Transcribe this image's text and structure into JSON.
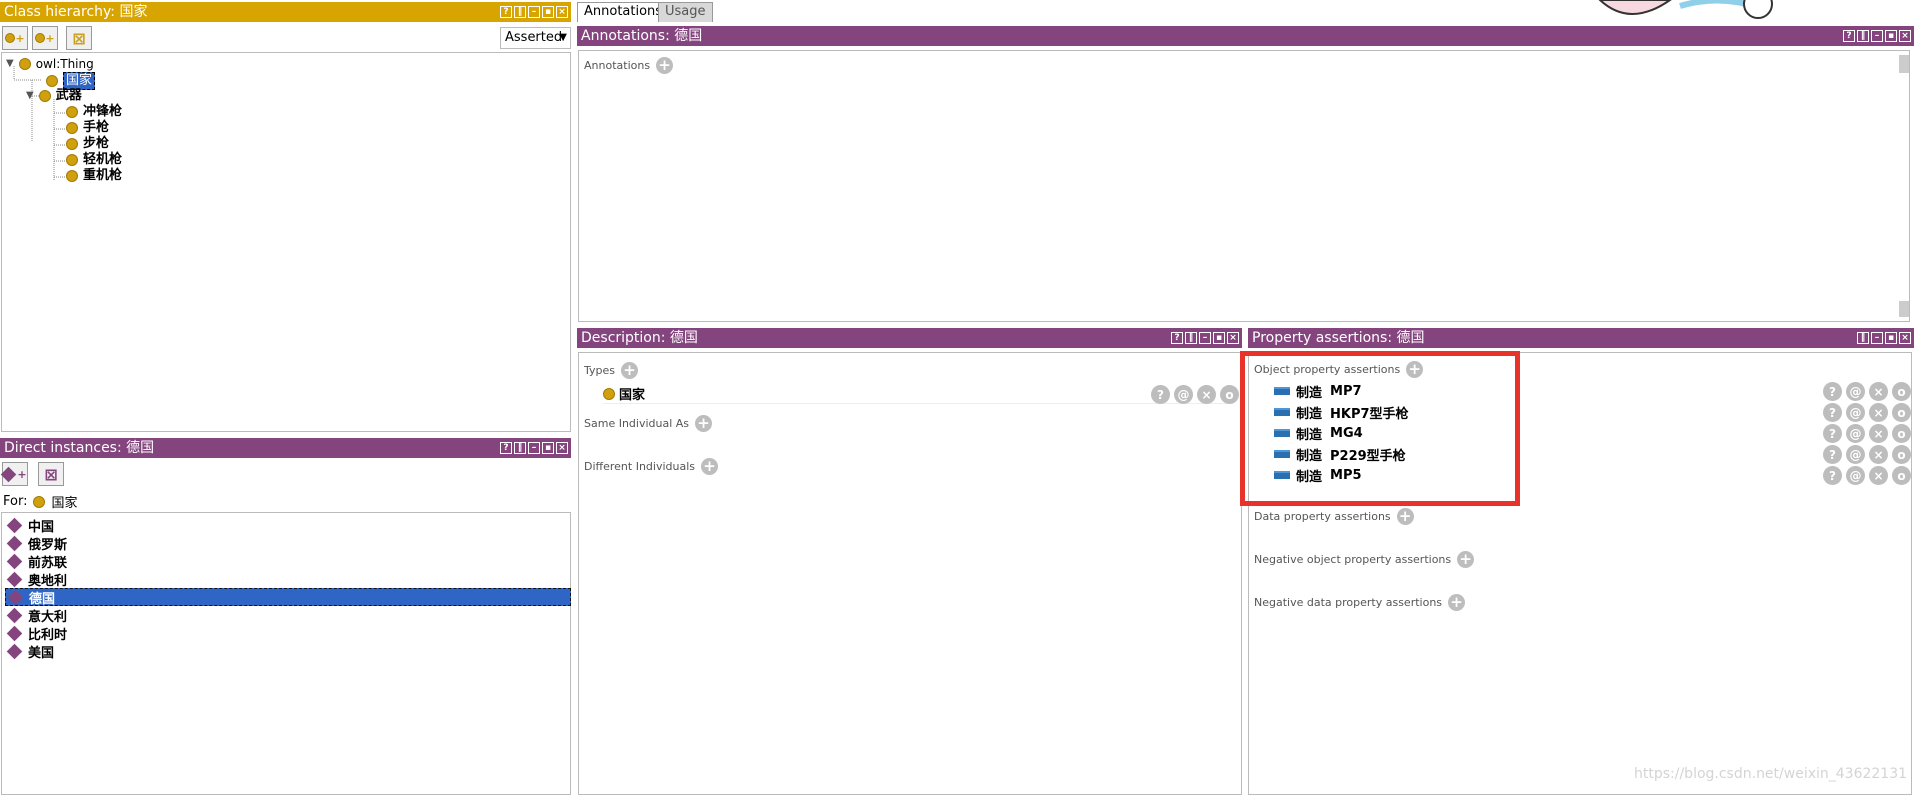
{
  "class_hierarchy": {
    "title": "Class hierarchy: 国家",
    "reasoner_mode": "Asserted",
    "tree": {
      "root": "owl:Thing",
      "n1": "国家",
      "n2": "武器",
      "children": [
        "冲锋枪",
        "手枪",
        "步枪",
        "轻机枪",
        "重机枪"
      ]
    }
  },
  "direct_instances": {
    "title": "Direct instances: 德国",
    "for_label": "For:",
    "for_value": "国家",
    "items": [
      "中国",
      "俄罗斯",
      "前苏联",
      "奥地利",
      "德国",
      "意大利",
      "比利时",
      "美国"
    ],
    "selected_index": 4
  },
  "tabs": {
    "annotations": "Annotations",
    "usage": "Usage"
  },
  "annotations_panel": {
    "title": "Annotations: 德国",
    "section": "Annotations"
  },
  "description": {
    "title": "Description: 德国",
    "types_label": "Types",
    "type_value": "国家",
    "same_individual": "Same Individual As",
    "different_individuals": "Different Individuals"
  },
  "property_assertions": {
    "title": "Property assertions: 德国",
    "object_label": "Object property assertions",
    "rows": [
      {
        "prop": "制造",
        "value": "MP7"
      },
      {
        "prop": "制造",
        "value": "HKP7型手枪"
      },
      {
        "prop": "制造",
        "value": "MG4"
      },
      {
        "prop": "制造",
        "value": "P229型手枪"
      },
      {
        "prop": "制造",
        "value": "MP5"
      }
    ],
    "data_label": "Data property assertions",
    "neg_object_label": "Negative object property assertions",
    "neg_data_label": "Negative data property assertions"
  },
  "watermark": "https://blog.csdn.net/weixin_43622131",
  "highlight_color": "#e8322a"
}
